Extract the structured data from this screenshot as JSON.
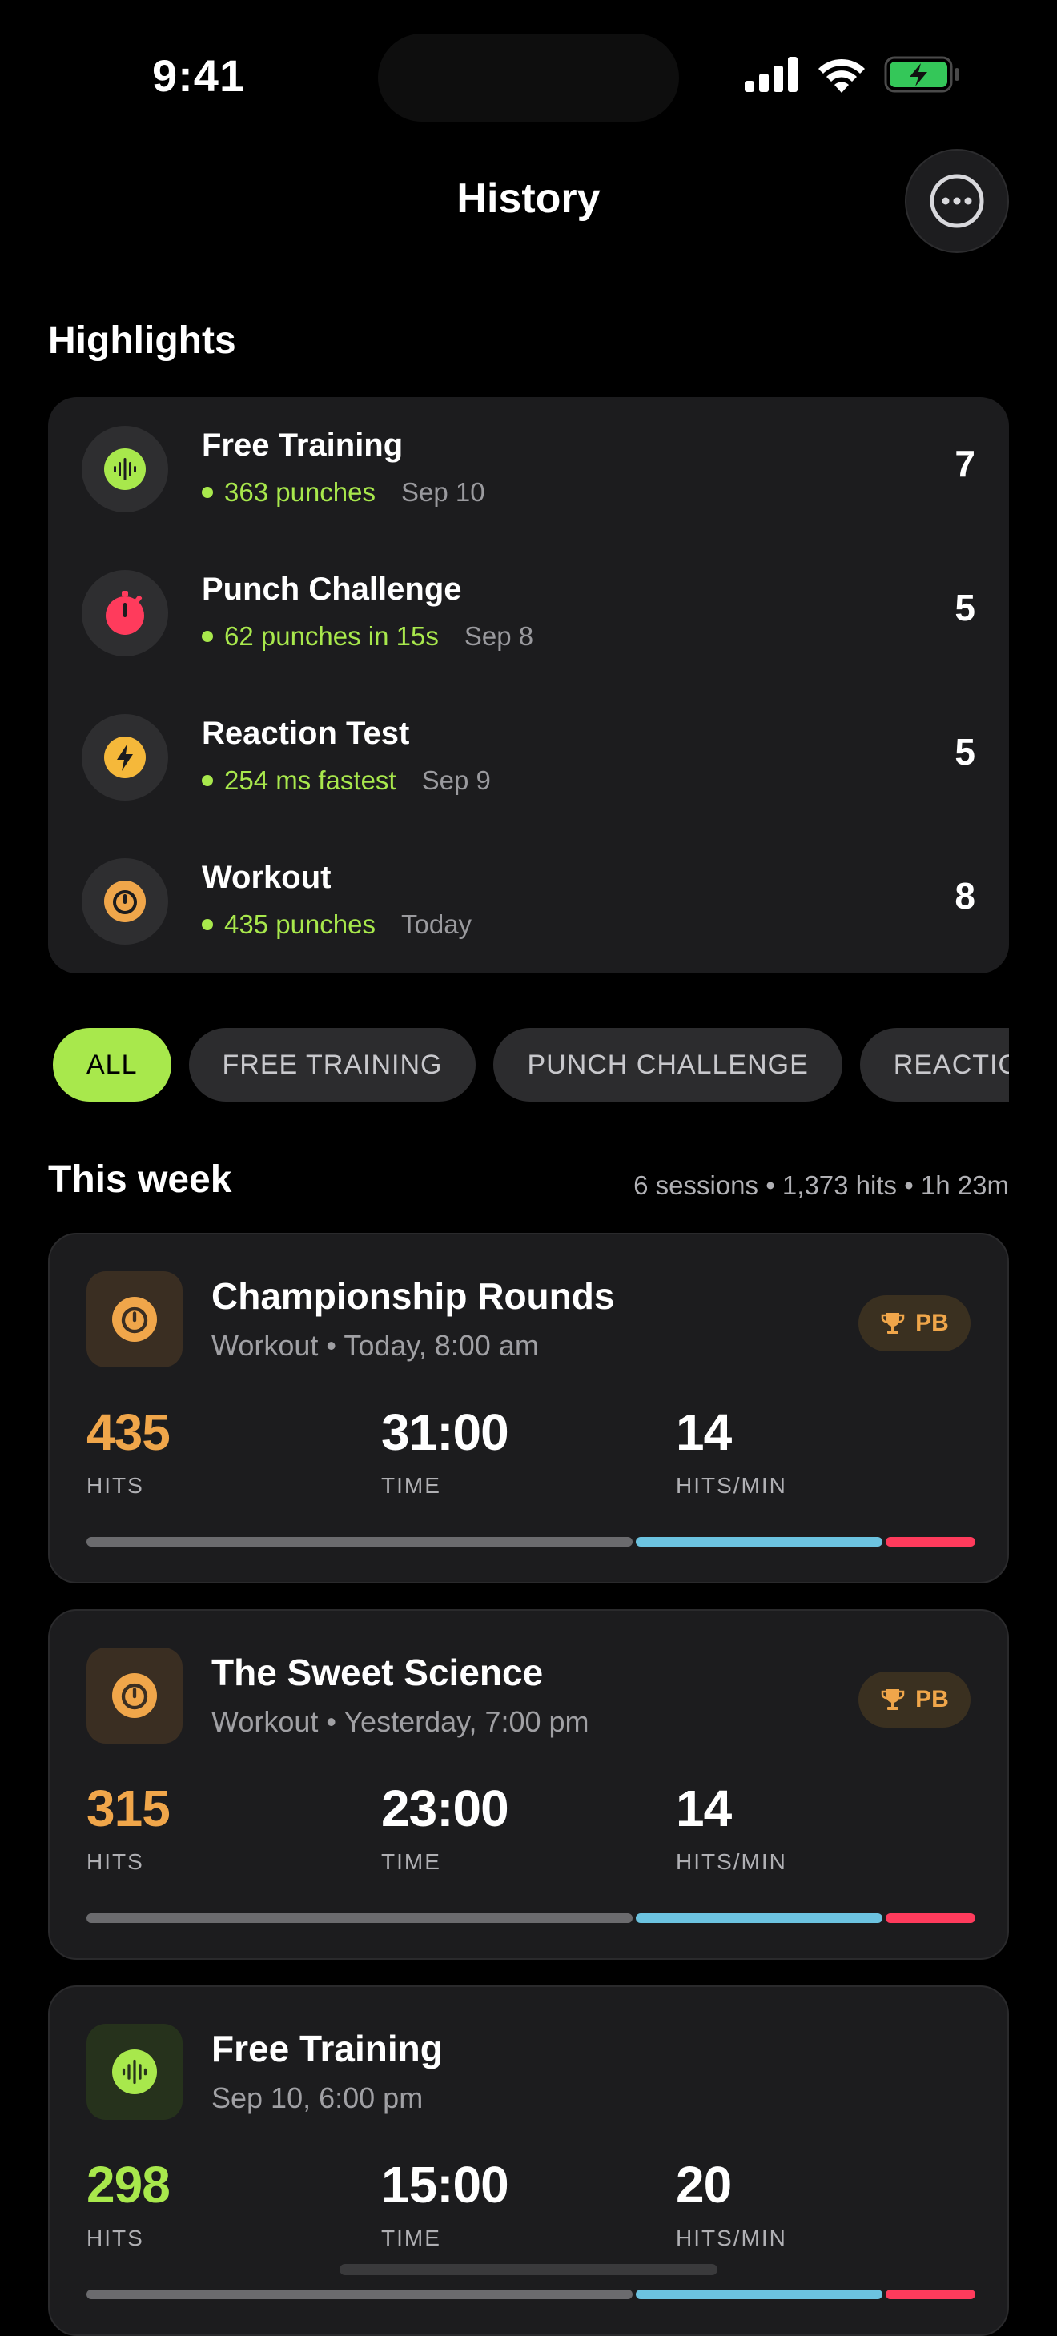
{
  "status_bar": {
    "time": "9:41"
  },
  "nav": {
    "title": "History"
  },
  "highlights": {
    "title": "Highlights",
    "items": [
      {
        "title": "Free Training",
        "metric": "363 punches",
        "date": "Sep 10",
        "count": "7",
        "icon": "waveform-icon",
        "color": "#a8e84c"
      },
      {
        "title": "Punch Challenge",
        "metric": "62 punches in 15s",
        "date": "Sep 8",
        "count": "5",
        "icon": "stopwatch-icon",
        "color": "#ff3b5c"
      },
      {
        "title": "Reaction Test",
        "metric": "254 ms fastest",
        "date": "Sep 9",
        "count": "5",
        "icon": "bolt-icon",
        "color": "#f5b83a"
      },
      {
        "title": "Workout",
        "metric": "435 punches",
        "date": "Today",
        "count": "8",
        "icon": "timer-icon",
        "color": "#f0a64a"
      }
    ]
  },
  "filters": [
    "ALL",
    "FREE TRAINING",
    "PUNCH CHALLENGE",
    "REACTION TEST"
  ],
  "week": {
    "title": "This week",
    "summary": "6 sessions • 1,373 hits • 1h 23m"
  },
  "sessions": [
    {
      "title": "Championship Rounds",
      "subtitle": "Workout • Today, 8:00 am",
      "badge": "PB",
      "hits": "435",
      "hits_label": "HITS",
      "time": "31:00",
      "time_label": "TIME",
      "rate": "14",
      "rate_label": "HITS/MIN",
      "accent": "#f0a64a",
      "icon": "timer-icon"
    },
    {
      "title": "The Sweet Science",
      "subtitle": "Workout • Yesterday, 7:00 pm",
      "badge": "PB",
      "hits": "315",
      "hits_label": "HITS",
      "time": "23:00",
      "time_label": "TIME",
      "rate": "14",
      "rate_label": "HITS/MIN",
      "accent": "#f0a64a",
      "icon": "timer-icon"
    },
    {
      "title": "Free Training",
      "subtitle": "Sep 10, 6:00 pm",
      "hits": "298",
      "hits_label": "HITS",
      "time": "15:00",
      "time_label": "TIME",
      "rate": "20",
      "rate_label": "HITS/MIN",
      "accent": "#a8e84c",
      "icon": "waveform-icon"
    }
  ],
  "colors": {
    "accent_green": "#a8e84c",
    "bar_gray": "#6b6b6e",
    "bar_blue": "#6cc3e0",
    "bar_red": "#ff3b5c"
  }
}
